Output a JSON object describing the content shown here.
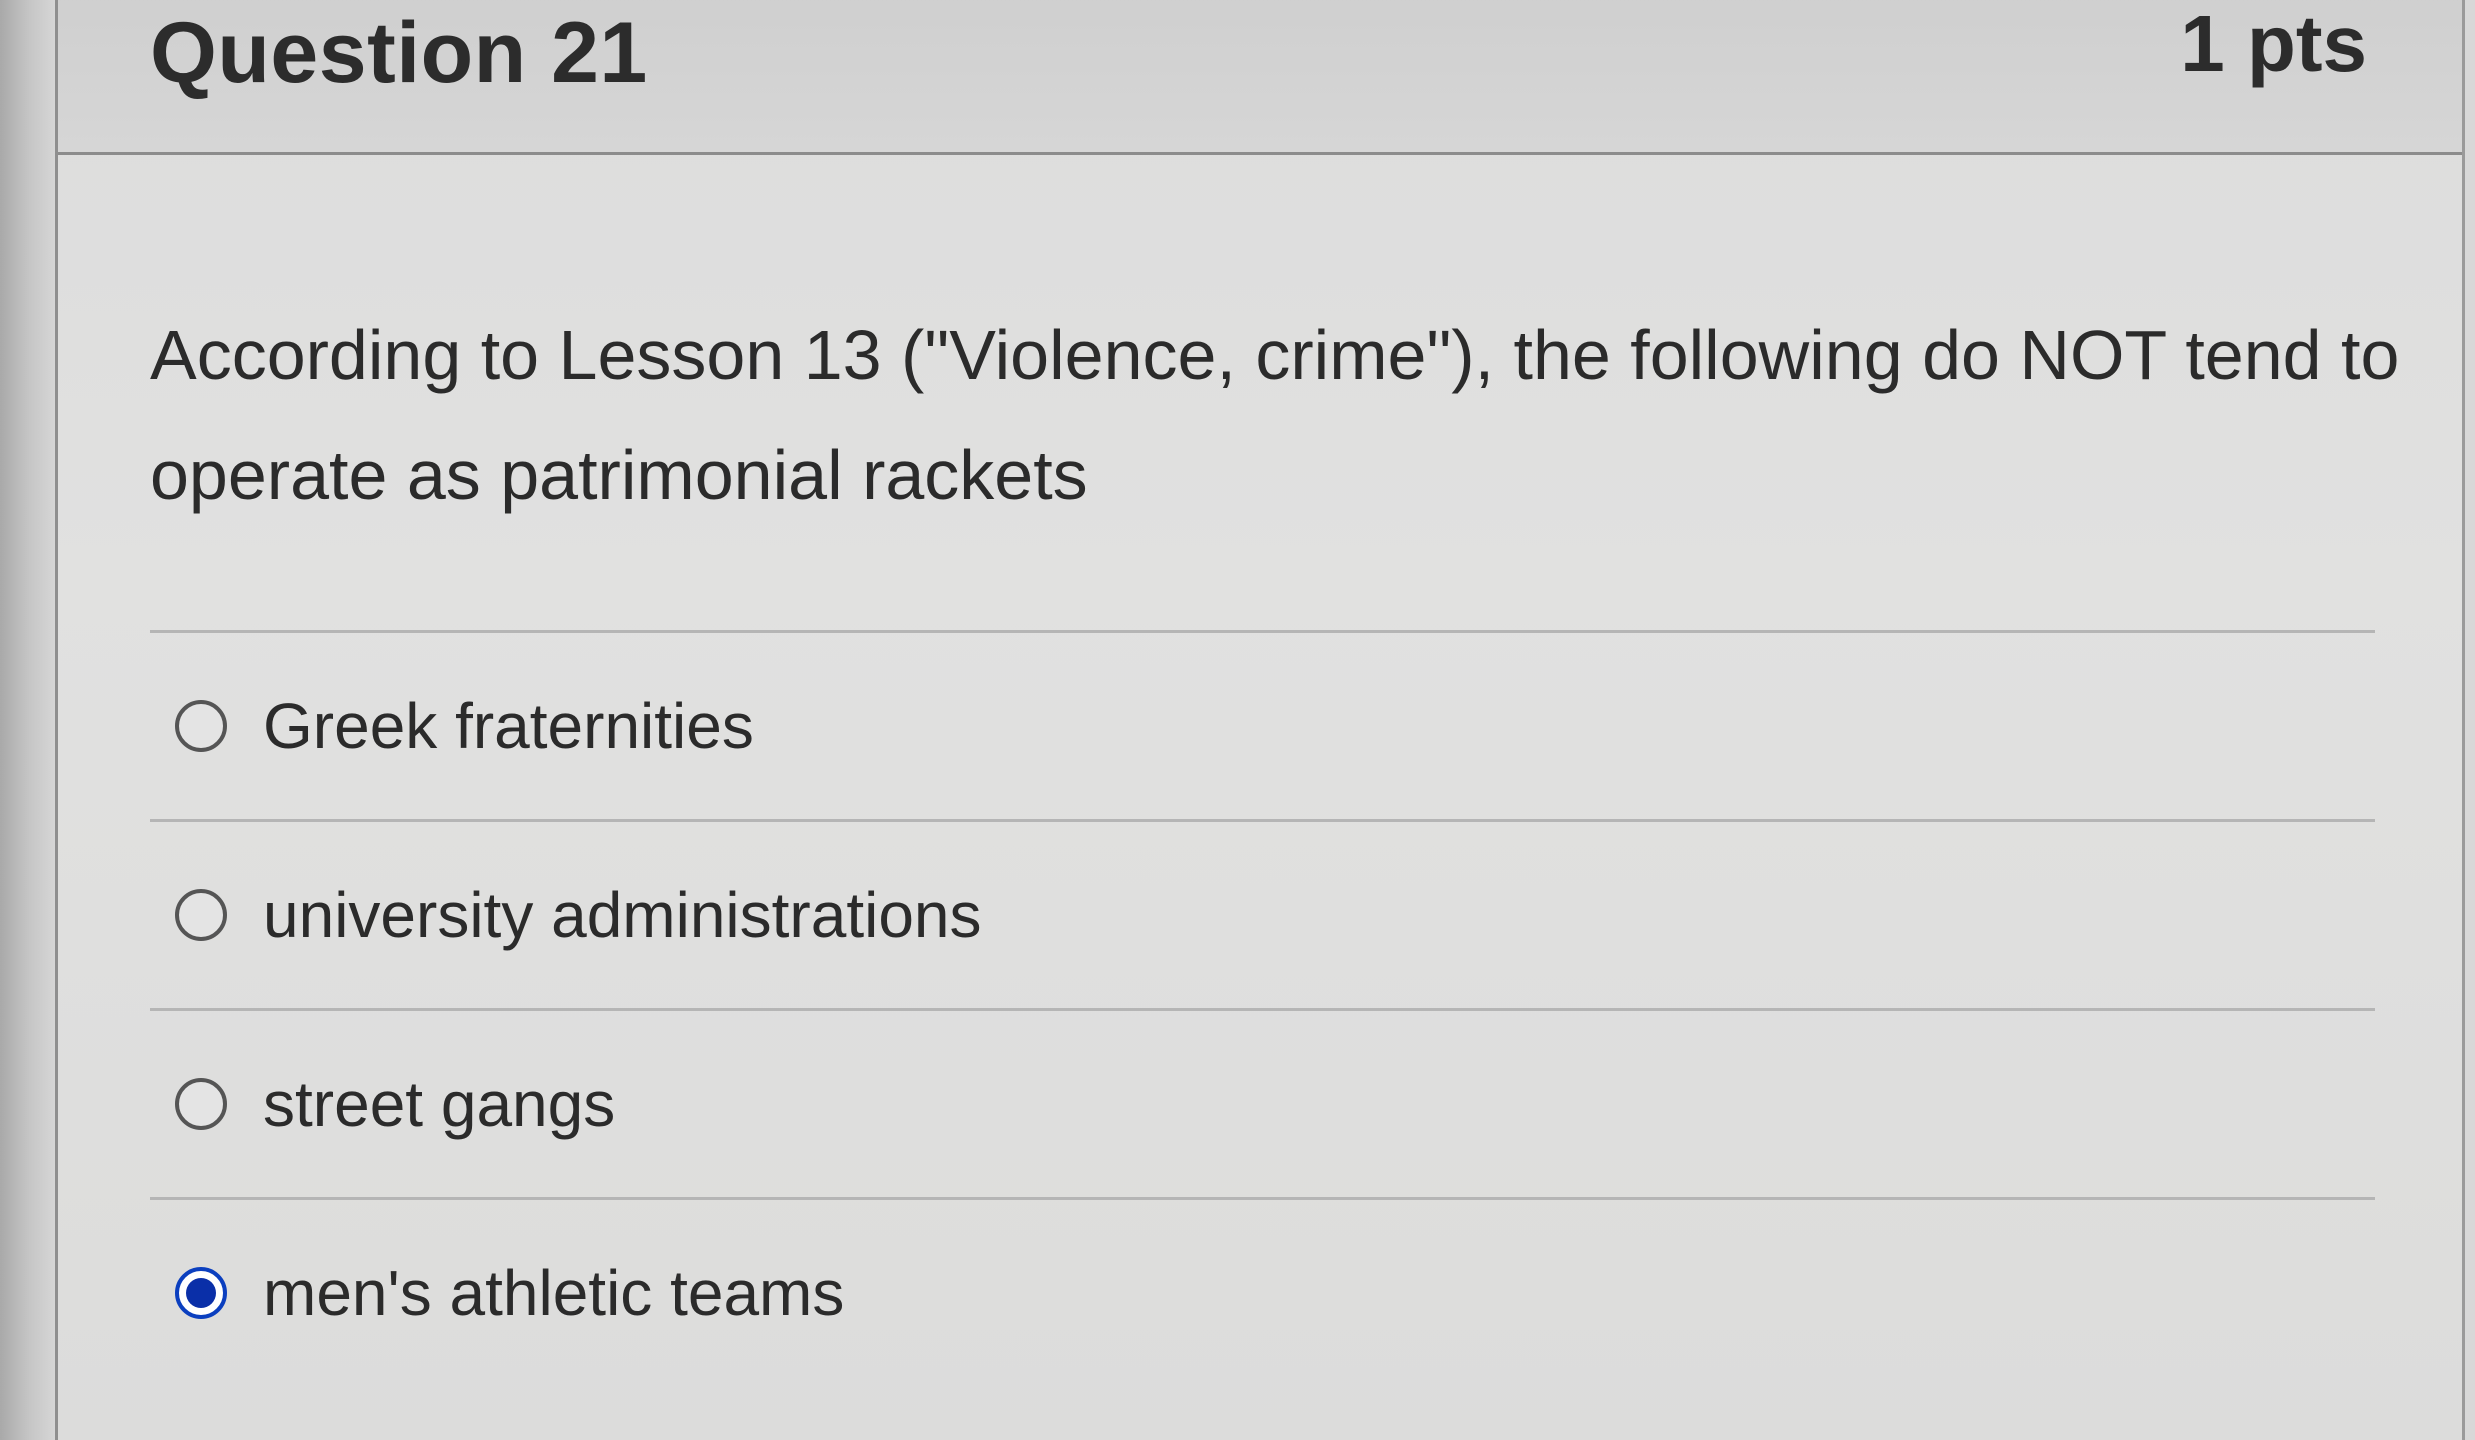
{
  "question": {
    "title": "Question 21",
    "points": "1 pts",
    "text": "According to Lesson 13 (\"Violence, crime\"), the following do NOT tend to operate as patrimonial rackets"
  },
  "answers": [
    {
      "label": "Greek fraternities",
      "selected": false
    },
    {
      "label": "university administrations",
      "selected": false
    },
    {
      "label": "street gangs",
      "selected": false
    },
    {
      "label": "men's athletic teams",
      "selected": true
    }
  ],
  "colors": {
    "selected_radio": "#0a2fa8",
    "text": "#2b2b2b"
  }
}
